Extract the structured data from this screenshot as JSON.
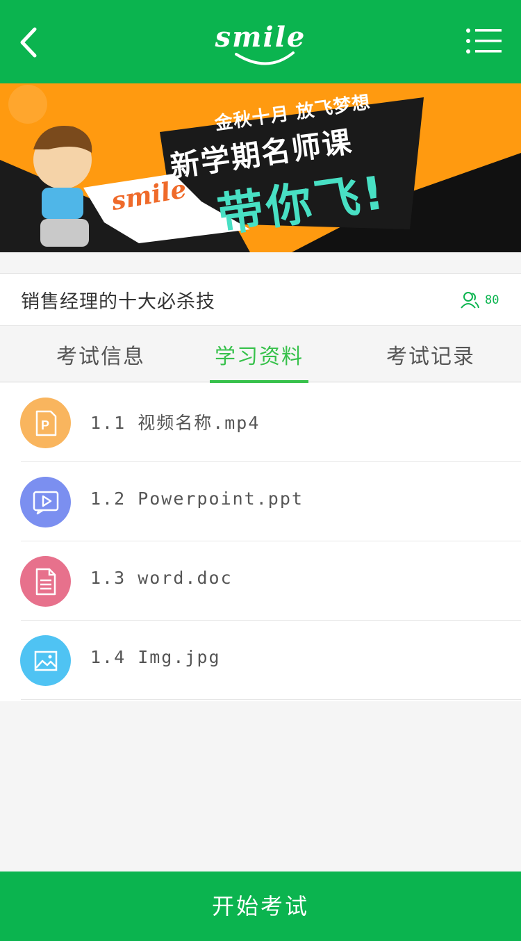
{
  "header": {
    "logo_text": "smile",
    "colors": {
      "brand_green": "#0bb44f"
    },
    "icons": {
      "back": "chevron-left-icon",
      "menu": "list-menu-icon"
    }
  },
  "banner": {
    "line1": "金秋十月 放飞梦想",
    "line2": "新学期名师课",
    "line3": "带你飞!",
    "brand": "smile",
    "colors": {
      "background": "#ff9a10",
      "accent": "#48e0c4",
      "brand": "#ef6a2a"
    }
  },
  "course": {
    "title": "销售经理的十大必杀技",
    "learner_count": "80",
    "learner_icon": "users-icon"
  },
  "tabs": [
    {
      "label": "考试信息",
      "active": false
    },
    {
      "label": "学习资料",
      "active": true
    },
    {
      "label": "考试记录",
      "active": false
    }
  ],
  "materials": [
    {
      "label": "1.1 视频名称.mp4",
      "icon": "ppt-icon",
      "color": "#f9b55e"
    },
    {
      "label": "1.2 Powerpoint.ppt",
      "icon": "video-icon",
      "color": "#7b8ff0"
    },
    {
      "label": "1.3 word.doc",
      "icon": "document-icon",
      "color": "#e7718c"
    },
    {
      "label": "1.4 Img.jpg",
      "icon": "image-icon",
      "color": "#4fc3f3"
    }
  ],
  "footer": {
    "start_label": "开始考试"
  }
}
